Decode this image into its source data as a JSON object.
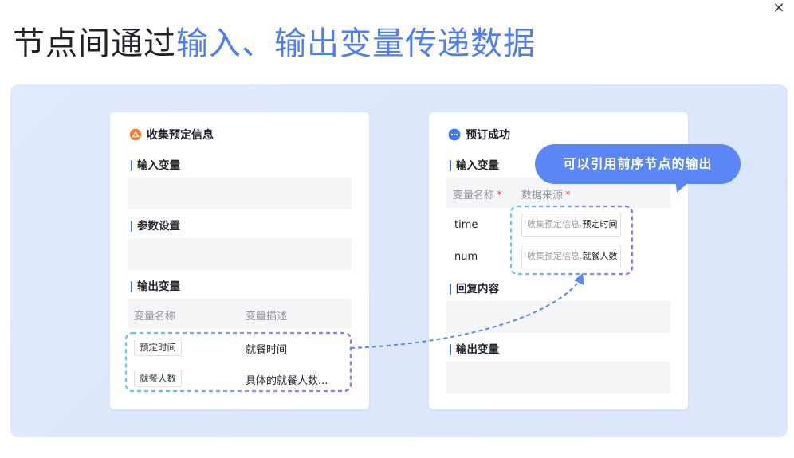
{
  "dialog": {
    "close_glyph": "×"
  },
  "headline": {
    "dark": "节点间通过",
    "blue": "输入、输出变量传递数据"
  },
  "tooltip": {
    "text": "可以引用前序节点的输出"
  },
  "left_card": {
    "icon": "node-gateway-icon",
    "title": "收集预定信息",
    "input_section": "输入变量",
    "params_section": "参数设置",
    "output_section": "输出变量",
    "columns": [
      "变量名称",
      "变量描述"
    ],
    "rows": [
      {
        "name": "预定时间",
        "desc": "就餐时间"
      },
      {
        "name": "就餐人数",
        "desc": "具体的就餐人数..."
      }
    ]
  },
  "right_card": {
    "icon": "chat-bubble-icon",
    "title": "预订成功",
    "input_section": "输入变量",
    "columns": [
      "变量名称",
      "数据来源"
    ],
    "required_mark": "*",
    "rows": [
      {
        "name": "time",
        "source": "收集预定信息.",
        "var": "预定时间"
      },
      {
        "name": "num",
        "source": "收集预定信息.",
        "var": "就餐人数"
      }
    ],
    "reply_section": "回复内容",
    "output_section": "输出变量"
  },
  "colors": {
    "accent": "#4d7cf6",
    "tooltip": "#5b86f5",
    "dash_start": "#62c8f0",
    "dash_end": "#9b6cf5"
  }
}
